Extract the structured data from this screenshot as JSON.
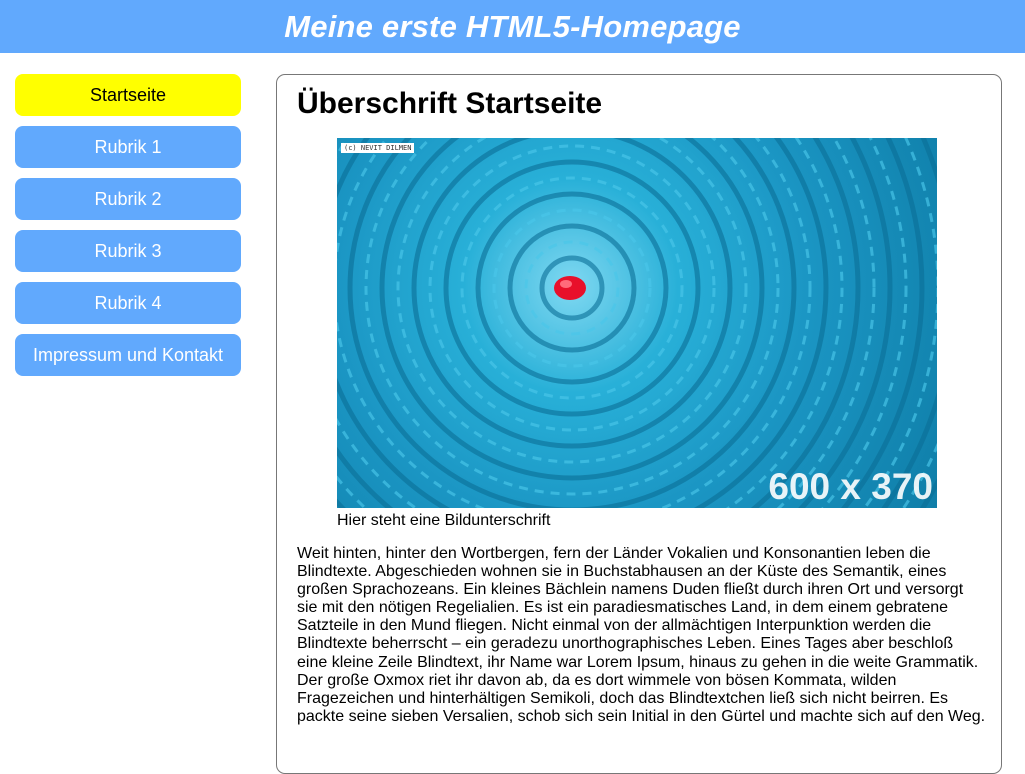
{
  "header": {
    "title": "Meine erste HTML5-Homepage"
  },
  "nav": {
    "items": [
      {
        "label": "Startseite",
        "active": true
      },
      {
        "label": "Rubrik 1"
      },
      {
        "label": "Rubrik 2"
      },
      {
        "label": "Rubrik 3"
      },
      {
        "label": "Rubrik 4"
      },
      {
        "label": "Impressum und Kontakt"
      }
    ]
  },
  "main": {
    "heading": "Überschrift Startseite",
    "image": {
      "credit": "(c) NEVIT DILMEN",
      "dimensions_label": "600 x 370",
      "caption": "Hier steht eine Bildunterschrift"
    },
    "paragraph": "Weit hinten, hinter den Wortbergen, fern der Länder Vokalien und Konsonantien leben die Blindtexte. Abgeschieden wohnen sie in Buchstabhausen an der Küste des Semantik, eines großen Sprachozeans. Ein kleines Bächlein namens Duden fließt durch ihren Ort und versorgt sie mit den nötigen Regelialien. Es ist ein paradiesmatisches Land, in dem einem gebratene Satzteile in den Mund fliegen. Nicht einmal von der allmächtigen Interpunktion werden die Blindtexte beherrscht – ein geradezu unorthographisches Leben. Eines Tages aber beschloß eine kleine Zeile Blindtext, ihr Name war Lorem Ipsum, hinaus zu gehen in die weite Grammatik. Der große Oxmox riet ihr davon ab, da es dort wimmele von bösen Kommata, wilden Fragezeichen und hinterhältigen Semikoli, doch das Blindtextchen ließ sich nicht beirren. Es packte seine sieben Versalien, schob sich sein Initial in den Gürtel und machte sich auf den Weg."
  },
  "colors": {
    "header": "#61a9fd",
    "nav": "#61a9fd",
    "nav_active": "#ffff00",
    "rope": "#1b96c4",
    "rope_core": "#e8102a"
  }
}
